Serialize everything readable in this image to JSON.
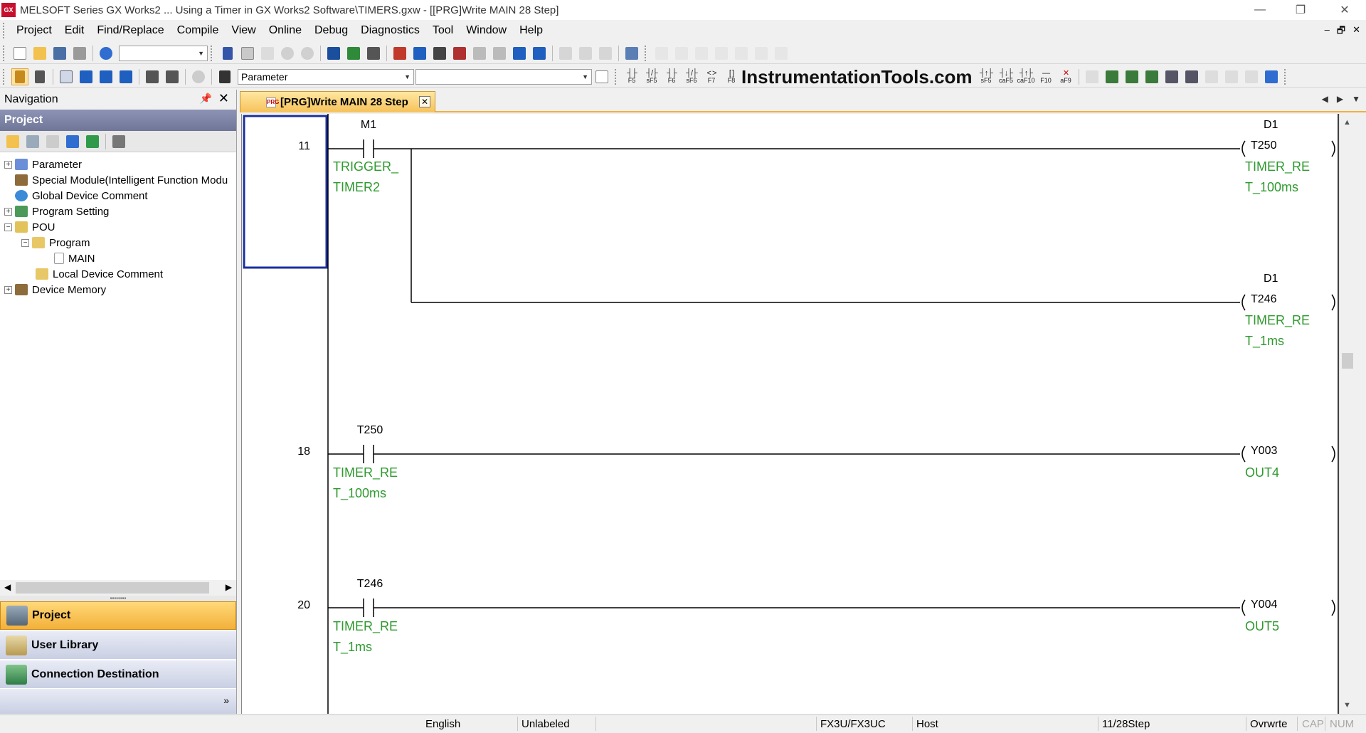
{
  "window": {
    "app_icon": "GX",
    "title": "MELSOFT Series GX Works2 ... Using a Timer in GX Works2 Software\\TIMERS.gxw - [[PRG]Write MAIN 28 Step]",
    "minimize": "—",
    "restore": "❐",
    "close": "✕"
  },
  "menu": [
    "Project",
    "Edit",
    "Find/Replace",
    "Compile",
    "View",
    "Online",
    "Debug",
    "Diagnostics",
    "Tool",
    "Window",
    "Help"
  ],
  "mdi_controls": {
    "minimize": "–",
    "restore": "🗗",
    "close": "✕"
  },
  "toolbar": {
    "combo1_value": "",
    "parameter_combo": "Parameter",
    "combo3_value": "",
    "watermark": "InstrumentationTools.com",
    "fkeys": [
      {
        "sym": "┤├",
        "key": "F5"
      },
      {
        "sym": "┤/├",
        "key": "sF5"
      },
      {
        "sym": "┤├",
        "key": "F6"
      },
      {
        "sym": "┤/├",
        "key": "sF6"
      },
      {
        "sym": "< >",
        "key": "F7"
      },
      {
        "sym": "[ ]",
        "key": "F8"
      }
    ],
    "fkeys2": [
      {
        "sym": "┤↑├",
        "key": "sF5"
      },
      {
        "sym": "┤↓├",
        "key": "caF5"
      },
      {
        "sym": "┤↑├",
        "key": "caF10"
      },
      {
        "sym": "—",
        "key": "F10"
      },
      {
        "sym": "✕",
        "key": "aF9"
      }
    ]
  },
  "navigation": {
    "header": "Navigation",
    "pin": "📌",
    "close": "✕",
    "section": "Project",
    "tree": [
      {
        "label": "Parameter",
        "expander": "+"
      },
      {
        "label": "Special Module(Intelligent Function Modu",
        "expander": ""
      },
      {
        "label": "Global Device Comment",
        "expander": ""
      },
      {
        "label": "Program Setting",
        "expander": "+"
      },
      {
        "label": "POU",
        "expander": "−"
      },
      {
        "label": "Program",
        "expander": "−"
      },
      {
        "label": "MAIN",
        "expander": ""
      },
      {
        "label": "Local Device Comment",
        "expander": ""
      },
      {
        "label": "Device Memory",
        "expander": "+"
      }
    ],
    "buttons": {
      "project": "Project",
      "user_library": "User Library",
      "connection": "Connection Destination",
      "more": "»"
    }
  },
  "tab": {
    "label": "[PRG]Write MAIN 28 Step",
    "icon": "PRG",
    "close": "✕",
    "nav_prev": "◀",
    "nav_next": "▶",
    "nav_menu": "▼"
  },
  "ladder": {
    "rungs": [
      {
        "step": "11",
        "contact_device": "M1",
        "contact_comment": [
          "TRIGGER_",
          "TIMER2"
        ],
        "coils": [
          {
            "setting": "D1",
            "device": "T250",
            "comment": [
              "TIMER_RE",
              "T_100ms"
            ]
          },
          {
            "setting": "D1",
            "device": "T246",
            "comment": [
              "TIMER_RE",
              "T_1ms"
            ]
          }
        ]
      },
      {
        "step": "18",
        "contact_device": "T250",
        "contact_comment": [
          "TIMER_RE",
          "T_100ms"
        ],
        "coils": [
          {
            "setting": "",
            "device": "Y003",
            "comment": [
              "OUT4"
            ]
          }
        ]
      },
      {
        "step": "20",
        "contact_device": "T246",
        "contact_comment": [
          "TIMER_RE",
          "T_1ms"
        ],
        "coils": [
          {
            "setting": "",
            "device": "Y004",
            "comment": [
              "OUT5"
            ]
          }
        ]
      }
    ]
  },
  "statusbar": {
    "language": "English",
    "label_mode": "Unlabeled",
    "cpu": "FX3U/FX3UC",
    "connection": "Host",
    "step": "11/28Step",
    "mode": "Ovrwrte",
    "cap": "CAP",
    "num": "NUM"
  },
  "colors": {
    "comment_green": "#2e9a2e",
    "cursor_blue": "#1a2f9e",
    "nav_section": "#7a81a3",
    "active_orange": "#f3b03a"
  }
}
